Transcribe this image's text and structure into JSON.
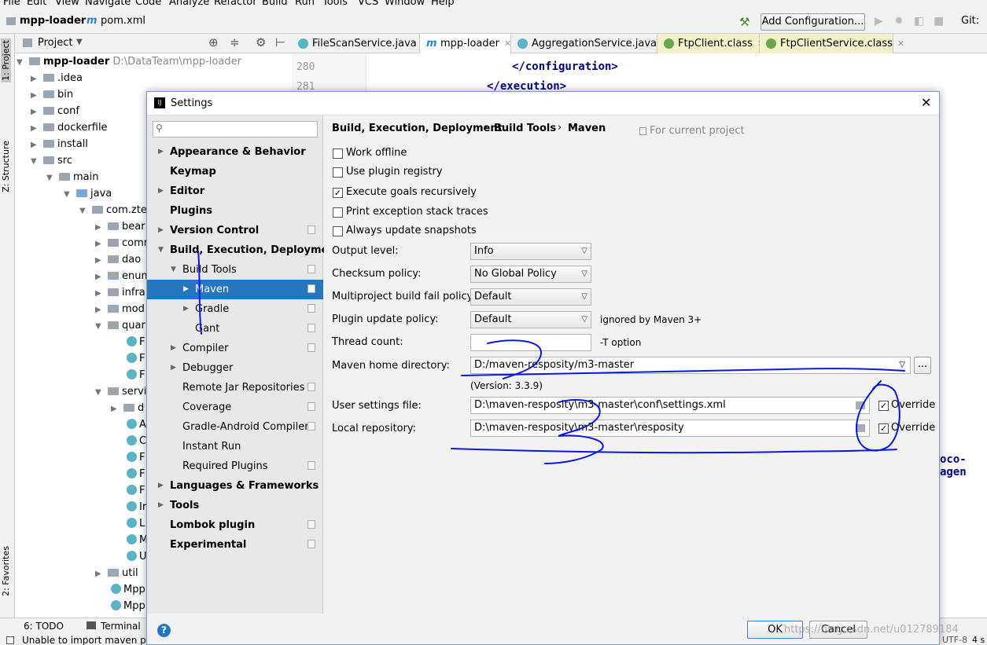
{
  "menu": [
    "File",
    "Edit",
    "View",
    "Navigate",
    "Code",
    "Analyze",
    "Refactor",
    "Build",
    "Run",
    "Tools",
    "VCS",
    "Window",
    "Help"
  ],
  "breadcrumb": {
    "project": "mpp-loader",
    "file": "pom.xml"
  },
  "toolbar": {
    "add_config": "Add Configuration...",
    "git": "Git:"
  },
  "left_strip": {
    "project_tab": "1: Project",
    "structure_tab": "Z: Structure",
    "favorites_tab": "2: Favorites"
  },
  "project_panel": {
    "title": "Project"
  },
  "tree": [
    {
      "label": "mpp-loader",
      "extra": "D:\\DataTeam\\mpp-loader"
    },
    {
      "label": ".idea"
    },
    {
      "label": "bin"
    },
    {
      "label": "conf"
    },
    {
      "label": "dockerfile"
    },
    {
      "label": "install"
    },
    {
      "label": "src"
    },
    {
      "label": "main"
    },
    {
      "label": "java"
    },
    {
      "label": "com.zte."
    },
    {
      "label": "bear"
    },
    {
      "label": "comr"
    },
    {
      "label": "dao"
    },
    {
      "label": "enum"
    },
    {
      "label": "infra"
    },
    {
      "label": "mod"
    },
    {
      "label": "quar"
    },
    {
      "label": "F"
    },
    {
      "label": "F"
    },
    {
      "label": "F"
    },
    {
      "label": "servi"
    },
    {
      "label": "d"
    },
    {
      "label": "A"
    },
    {
      "label": "C"
    },
    {
      "label": "F"
    },
    {
      "label": "F"
    },
    {
      "label": "F"
    },
    {
      "label": "Ir"
    },
    {
      "label": "L"
    },
    {
      "label": "M"
    },
    {
      "label": "U"
    },
    {
      "label": "util"
    },
    {
      "label": "Mpp"
    },
    {
      "label": "Mpp"
    }
  ],
  "editor_tabs": [
    "FileScanService.java",
    "mpp-loader",
    "AggregationService.java",
    "FtpClient.class",
    "FtpClientService.class"
  ],
  "editor": {
    "line1": "280",
    "line2": "281",
    "code1": "</configuration>",
    "code2": "</execution>",
    "partial": "oco-agen"
  },
  "bottom_tabs": {
    "todo": "6: TODO",
    "terminal": "Terminal"
  },
  "status": {
    "message": "Unable to import maven pr",
    "encoding": "UTF-8",
    "indent": "4 s"
  },
  "dialog": {
    "title": "Settings",
    "search_placeholder": "",
    "nav": [
      {
        "label": "Appearance & Behavior"
      },
      {
        "label": "Keymap"
      },
      {
        "label": "Editor"
      },
      {
        "label": "Plugins"
      },
      {
        "label": "Version Control"
      },
      {
        "label": "Build, Execution, Deployment"
      },
      {
        "label": "Build Tools"
      },
      {
        "label": "Maven"
      },
      {
        "label": "Gradle"
      },
      {
        "label": "Gant"
      },
      {
        "label": "Compiler"
      },
      {
        "label": "Debugger"
      },
      {
        "label": "Remote Jar Repositories"
      },
      {
        "label": "Coverage"
      },
      {
        "label": "Gradle-Android Compiler"
      },
      {
        "label": "Instant Run"
      },
      {
        "label": "Required Plugins"
      },
      {
        "label": "Languages & Frameworks"
      },
      {
        "label": "Tools"
      },
      {
        "label": "Lombok plugin"
      },
      {
        "label": "Experimental"
      }
    ],
    "breadcrumb": {
      "a": "Build, Execution, Deployment",
      "b": "Build Tools",
      "c": "Maven",
      "scope": "For current project"
    },
    "checkboxes": [
      {
        "label": "Work offline",
        "checked": false
      },
      {
        "label": "Use plugin registry",
        "checked": false
      },
      {
        "label": "Execute goals recursively",
        "checked": true
      },
      {
        "label": "Print exception stack traces",
        "checked": false
      },
      {
        "label": "Always update snapshots",
        "checked": false
      }
    ],
    "fields": {
      "output_level": {
        "label": "Output level:",
        "value": "Info"
      },
      "checksum": {
        "label": "Checksum policy:",
        "value": "No Global Policy"
      },
      "multiproject": {
        "label": "Multiproject build fail policy:",
        "value": "Default"
      },
      "plugin_update": {
        "label": "Plugin update policy:",
        "value": "Default",
        "note": "ignored by Maven 3+"
      },
      "thread_count": {
        "label": "Thread count:",
        "value": "",
        "note": "-T option"
      },
      "maven_home": {
        "label": "Maven home directory:",
        "value": "D:/maven-resposity/m3-master",
        "version": "(Version: 3.3.9)"
      },
      "user_settings": {
        "label": "User settings file:",
        "value": "D:\\maven-resposity\\m3-master\\conf\\settings.xml",
        "override": "Override"
      },
      "local_repo": {
        "label": "Local repository:",
        "value": "D:\\maven-resposity\\m3-master\\resposity",
        "override": "Override"
      }
    },
    "buttons": {
      "ok": "OK",
      "cancel": "Cancel",
      "browse": "...",
      "help": "?"
    },
    "watermark": "https://blog.csdn.net/u012789184"
  },
  "colors": {
    "selection": "#2675bf",
    "annotation": "#0a1adb"
  }
}
